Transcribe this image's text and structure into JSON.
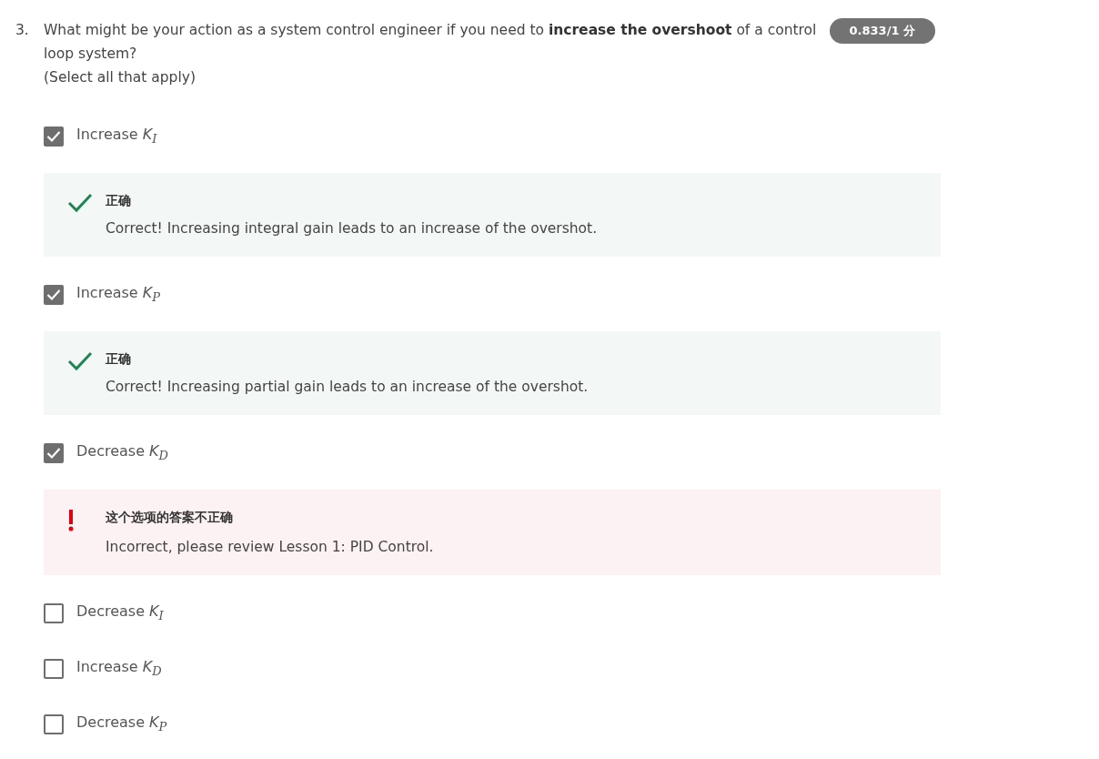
{
  "question": {
    "number": "3.",
    "text": "What might be your action as a system control engineer if you need to **increase the overshoot** of a control loop system?",
    "hint": "(Select all that apply)",
    "score": "0.833/1 分"
  },
  "options": [
    {
      "label": "Increase *K*$_{I}$",
      "checked": true,
      "feedback": {
        "kind": "correct",
        "title": "正确",
        "text": "Correct! Increasing integral gain leads to an increase of the overshot."
      }
    },
    {
      "label": "Increase *K*$_{P}$",
      "checked": true,
      "feedback": {
        "kind": "correct",
        "title": "正确",
        "text": "Correct! Increasing partial gain leads to an increase of the overshot."
      }
    },
    {
      "label": "Decrease *K*$_{D}$",
      "checked": true,
      "feedback": {
        "kind": "incorrect",
        "title": "这个选项的答案不正确",
        "text": "Incorrect, please review Lesson 1: PID Control."
      }
    },
    {
      "label": "Decrease *K*$_{I}$",
      "checked": false
    },
    {
      "label": "Increase *K*$_{D}$",
      "checked": false
    },
    {
      "label": "Decrease *K*$_{P}$",
      "checked": false
    }
  ]
}
